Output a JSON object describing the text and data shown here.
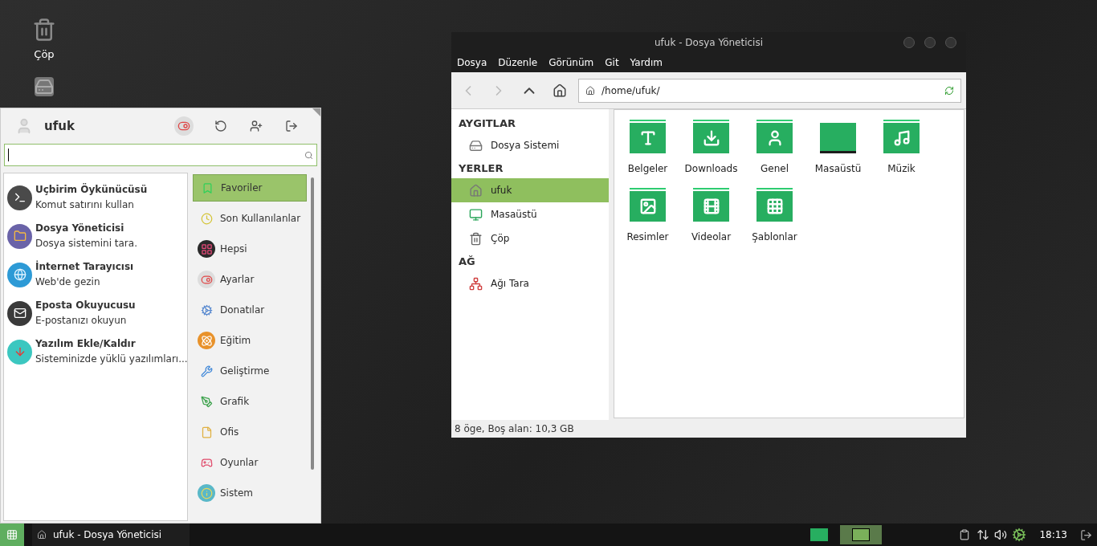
{
  "desktop": {
    "icons": [
      {
        "kind": "trash",
        "label": "Çöp"
      },
      {
        "kind": "drive"
      }
    ]
  },
  "menu": {
    "user": "ufuk",
    "favorites": [
      {
        "kind": "terminal",
        "title": "Uçbirim Öykünücüsü",
        "subtitle": "Komut satırını kullan"
      },
      {
        "kind": "files",
        "title": "Dosya Yöneticisi",
        "subtitle": "Dosya sistemini tara."
      },
      {
        "kind": "web",
        "title": "İnternet Tarayıcısı",
        "subtitle": "Web'de gezin"
      },
      {
        "kind": "mail",
        "title": "Eposta Okuyucusu",
        "subtitle": "E-postanızı okuyun"
      },
      {
        "kind": "software",
        "title": "Yazılım Ekle/Kaldır",
        "subtitle": "Sisteminizde yüklü yazılımları..."
      }
    ],
    "categories": [
      {
        "kind": "favorites",
        "label": "Favoriler",
        "selected": true
      },
      {
        "kind": "recent",
        "label": "Son Kullanılanlar",
        "selected": false
      },
      {
        "kind": "all",
        "label": "Hepsi",
        "selected": false
      },
      {
        "kind": "settings",
        "label": "Ayarlar",
        "selected": false
      },
      {
        "kind": "accessories",
        "label": "Donatılar",
        "selected": false
      },
      {
        "kind": "education",
        "label": "Eğitim",
        "selected": false
      },
      {
        "kind": "development",
        "label": "Geliştirme",
        "selected": false
      },
      {
        "kind": "graphics",
        "label": "Grafik",
        "selected": false
      },
      {
        "kind": "office",
        "label": "Ofis",
        "selected": false
      },
      {
        "kind": "games",
        "label": "Oyunlar",
        "selected": false
      },
      {
        "kind": "system",
        "label": "Sistem",
        "selected": false
      }
    ]
  },
  "file_manager": {
    "title": "ufuk - Dosya Yöneticisi",
    "menus": [
      "Dosya",
      "Düzenle",
      "Görünüm",
      "Git",
      "Yardım"
    ],
    "path": "/home/ufuk/",
    "sidebar": [
      {
        "heading": "AYGITLAR",
        "items": [
          {
            "kind": "drive",
            "label": "Dosya Sistemi",
            "selected": false
          }
        ]
      },
      {
        "heading": "YERLER",
        "items": [
          {
            "kind": "home",
            "label": "ufuk",
            "selected": true
          },
          {
            "kind": "desktop",
            "label": "Masaüstü",
            "selected": false
          },
          {
            "kind": "trash",
            "label": "Çöp",
            "selected": false
          }
        ]
      },
      {
        "heading": "AĞ",
        "items": [
          {
            "kind": "network",
            "label": "Ağı Tara",
            "selected": false
          }
        ]
      }
    ],
    "files": [
      {
        "kind": "documents",
        "name": "Belgeler"
      },
      {
        "kind": "download",
        "name": "Downloads"
      },
      {
        "kind": "public",
        "name": "Genel"
      },
      {
        "kind": "desktop",
        "name": "Masaüstü"
      },
      {
        "kind": "music",
        "name": "Müzik"
      },
      {
        "kind": "pictures",
        "name": "Resimler"
      },
      {
        "kind": "videos",
        "name": "Videolar"
      },
      {
        "kind": "templates",
        "name": "Şablonlar"
      }
    ],
    "status": "8 öge, Boş alan: 10,3 GB"
  },
  "taskbar": {
    "task": "ufuk - Dosya Yöneticisi",
    "workspaces": [
      {
        "selected": false
      },
      {
        "selected": true
      }
    ],
    "clock": "18:13"
  }
}
